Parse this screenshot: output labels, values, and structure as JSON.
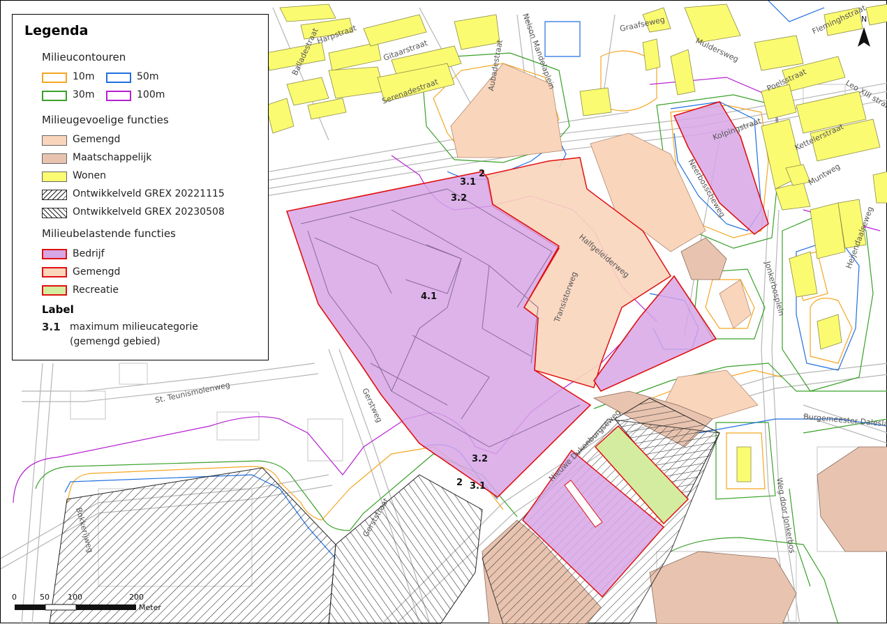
{
  "legend": {
    "title": "Legenda",
    "contours": {
      "heading": "Milieucontouren",
      "items": [
        {
          "label": "10m",
          "color": "#f5a623"
        },
        {
          "label": "50m",
          "color": "#1f6fe0"
        },
        {
          "label": "30m",
          "color": "#3aa02a"
        },
        {
          "label": "100m",
          "color": "#b51fd0"
        }
      ]
    },
    "sensitive": {
      "heading": "Milieugevoelige functies",
      "items": [
        {
          "label": "Gemengd",
          "color": "#f9d5bc"
        },
        {
          "label": "Maatschappelijk",
          "color": "#e8c4b0"
        },
        {
          "label": "Wonen",
          "color": "#fbfb71"
        },
        {
          "label": "Ontwikkelveld GREX 20221115",
          "pattern": "hatch-diagonal"
        },
        {
          "label": "Ontwikkelveld GREX 20230508",
          "pattern": "hatch-backslash"
        }
      ]
    },
    "burdening": {
      "heading": "Milieubelastende functies",
      "items": [
        {
          "label": "Bedrijf",
          "color": "#d7a6e6",
          "border": "#e01010"
        },
        {
          "label": "Gemengd",
          "color": "#f9d5bc",
          "border": "#e01010"
        },
        {
          "label": "Recreatie",
          "color": "#d4eca0",
          "border": "#e01010"
        }
      ]
    },
    "label_section": {
      "heading": "Label",
      "example_value": "3.1",
      "example_text_line1": "maximum milieucategorie",
      "example_text_line2": "(gemengd gebied)"
    }
  },
  "map_labels": {
    "l1": "2",
    "l2": "3.1",
    "l3": "3.2",
    "l4": "4.1",
    "l5": "3.2",
    "l6": "2",
    "l7": "3.1"
  },
  "streets": {
    "harpstraat": "Harpstraat",
    "balladestraat": "Balladestraat",
    "gitaarstraat": "Gitaarstraat",
    "serenadestraat": "Serenadestraat",
    "aubadestraat": "Aubadestraat",
    "nelson": "Nelson Mandelaplein",
    "graafseweg": "Graafseweg",
    "muldersweg": "Muldersweg",
    "fleminghstraat": "Fleminghstraat",
    "poelsstraat": "Poelsstraat",
    "leo": "Leo XIII straat",
    "kolpingstraat": "Kolpingstraat",
    "kettelerstraat": "Kettelerstraat",
    "muntweg": "Muntweg",
    "nerrbosscheweg": "Neerbosscheweg",
    "halfgeleiderweg": "Halfgeleiderweg",
    "transistorweg": "Transistorweg",
    "jonkerbosplein": "Jonkerbosplein",
    "heyendaalseweg": "Heijendaalseweg",
    "teunismolenweg": "St. Teunismolenweg",
    "gerstweg": "Gerstweg",
    "nieuwe_dukenburgseweg": "Nieuwe Dukenburgseweg",
    "burgemeester": "Burgemeester Daleslaan",
    "weg_door_jonkerbos": "Weg door Jonkerbos",
    "bokkerijweg": "Bokkerijweg",
    "gerststraat": "Gerststraat"
  },
  "north_arrow": {
    "letter": "N"
  },
  "scale_bar": {
    "ticks": [
      "0",
      "50",
      "100",
      "200"
    ],
    "unit": "Meter"
  },
  "colors": {
    "bedrijf_fill": "#d7a6e6",
    "red_border": "#e01010",
    "gemengd_fill": "#f9d5bc",
    "maatschappelijk_fill": "#e8c4b0",
    "wonen_fill": "#fbfb71",
    "recreatie_fill": "#d4eca0",
    "road_gray": "#b5b5b5"
  }
}
